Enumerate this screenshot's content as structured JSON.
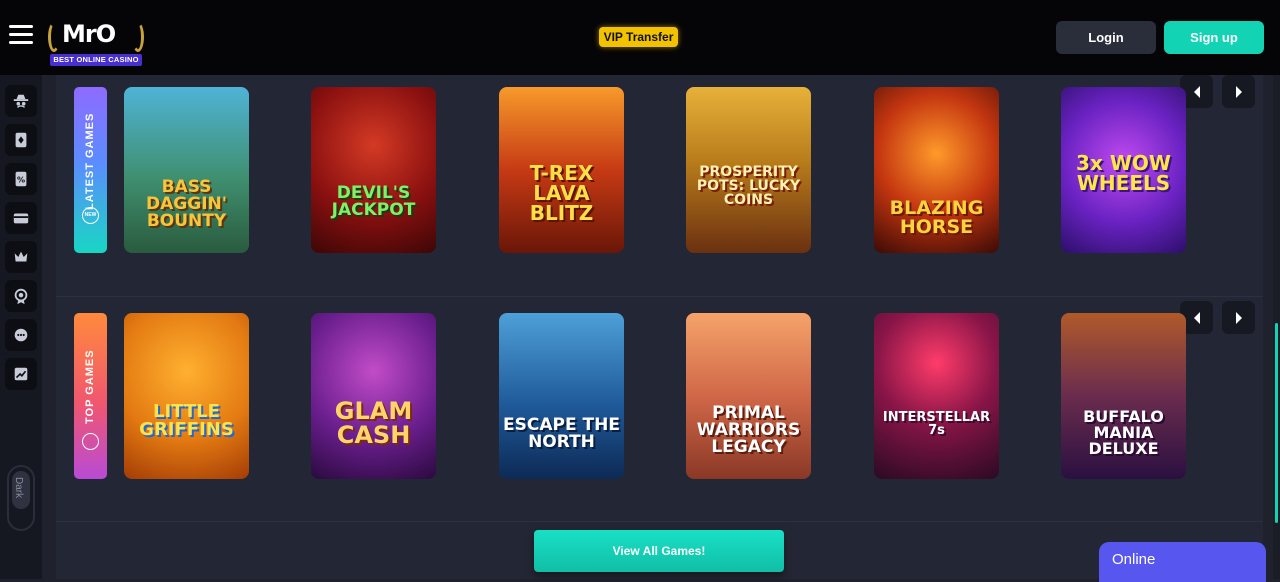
{
  "header": {
    "logo_text": "MrO",
    "logo_tagline": "BEST ONLINE CASINO",
    "vip_label": "VIP Transfer",
    "login_label": "Login",
    "signup_label": "Sign up"
  },
  "sidebar": {
    "icons": [
      "gentleman-icon",
      "playing-card-icon",
      "slot-chip-icon",
      "credit-card-icon",
      "crown-icon",
      "medal-icon",
      "live-chat-icon",
      "trending-chart-icon"
    ],
    "theme_toggle_label": "Dark"
  },
  "sections": [
    {
      "title": "LATEST GAMES",
      "badge": "NEW",
      "games": [
        {
          "name": "BASS DAGGIN' BOUNTY"
        },
        {
          "name": "DEVIL'S JACKPOT"
        },
        {
          "name": "T-REX LAVA BLITZ"
        },
        {
          "name": "PROSPERITY POTS: LUCKY COINS"
        },
        {
          "name": "BLAZING HORSE"
        },
        {
          "name": "3x WOW WHEELS"
        }
      ]
    },
    {
      "title": "TOP GAMES",
      "games": [
        {
          "name": "LITTLE GRIFFINS"
        },
        {
          "name": "GLAM CASH"
        },
        {
          "name": "ESCAPE THE NORTH"
        },
        {
          "name": "PRIMAL WARRIORS LEGACY"
        },
        {
          "name": "INTERSTELLAR 7s"
        },
        {
          "name": "BUFFALO MANIA DELUXE"
        }
      ]
    }
  ],
  "view_all_label": "View All Games!",
  "chat": {
    "status": "Online"
  },
  "colors": {
    "accent": "#12d4b4",
    "vip": "#f2c200",
    "chat": "#5757f0"
  }
}
